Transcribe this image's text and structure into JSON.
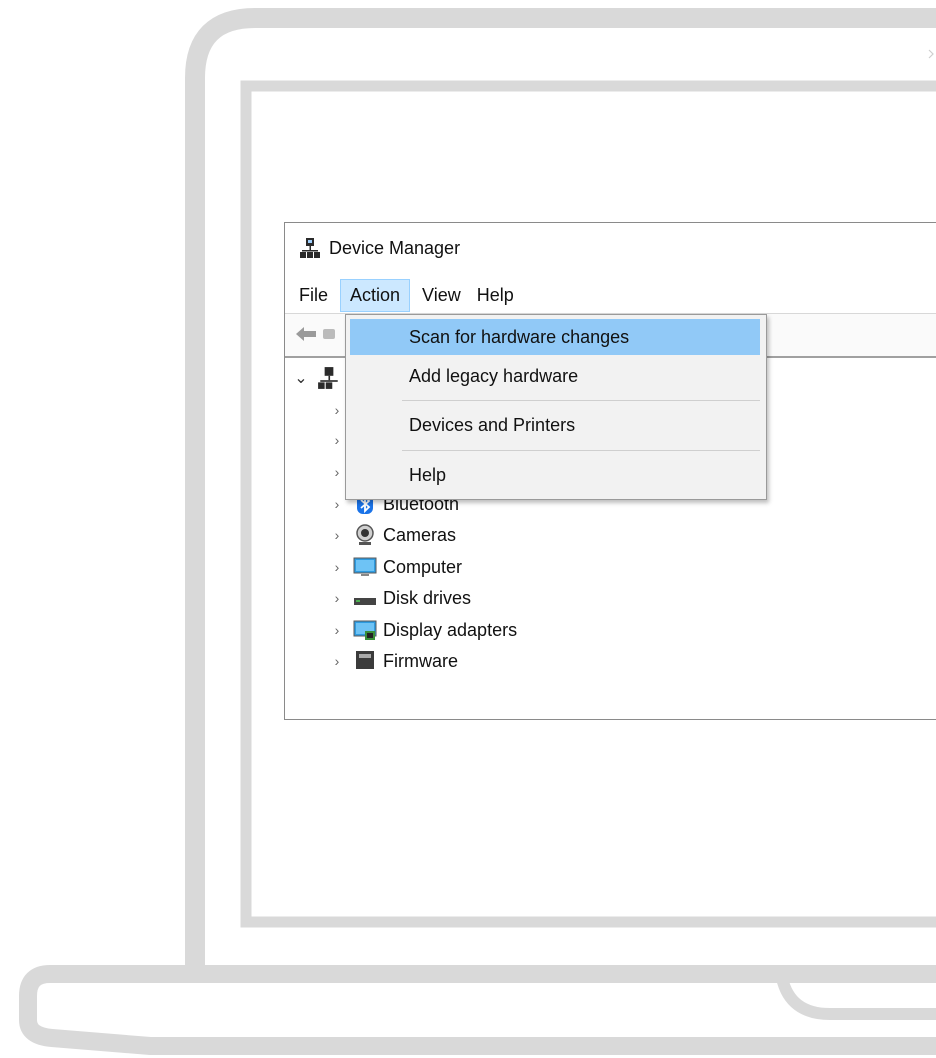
{
  "window": {
    "title": "Device Manager"
  },
  "menu_bar": {
    "items": [
      "File",
      "Action",
      "View",
      "Help"
    ],
    "active": "Action"
  },
  "context_menu": {
    "items": [
      {
        "label": "Scan for hardware changes",
        "highlighted": true
      },
      {
        "label": "Add legacy hardware",
        "highlighted": false
      },
      {
        "label": "Devices and Printers",
        "highlighted": false
      },
      {
        "label": "Help",
        "highlighted": false
      }
    ]
  },
  "tree": {
    "items": [
      {
        "label": "Bluetooth",
        "icon": "bluetooth-icon"
      },
      {
        "label": "Cameras",
        "icon": "camera-icon"
      },
      {
        "label": "Computer",
        "icon": "computer-icon"
      },
      {
        "label": "Disk drives",
        "icon": "disk-drive-icon"
      },
      {
        "label": "Display adapters",
        "icon": "display-adapter-icon"
      },
      {
        "label": "Firmware",
        "icon": "firmware-icon"
      }
    ]
  },
  "colors": {
    "laptop_outline": "#d9d9d9",
    "menu_highlight": "#91c9f7",
    "menu_active": "#cce8ff"
  }
}
